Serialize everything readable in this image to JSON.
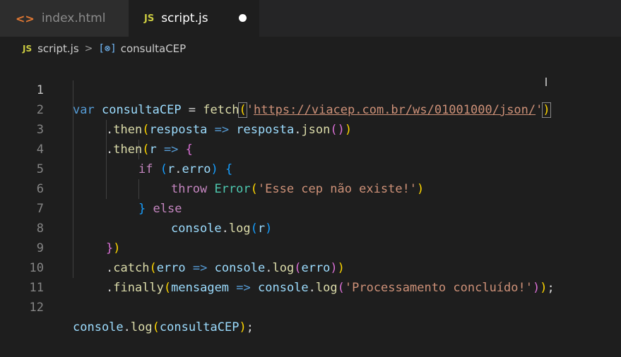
{
  "tabs": [
    {
      "label": "index.html",
      "icon": "<>",
      "active": false
    },
    {
      "label": "script.js",
      "icon": "JS",
      "active": true,
      "modified": true
    }
  ],
  "breadcrumb": {
    "file_icon": "JS",
    "file": "script.js",
    "separator": ">",
    "symbol_icon": "[⊗]",
    "symbol": "consultaCEP"
  },
  "editor": {
    "line_numbers": [
      "1",
      "2",
      "3",
      "4",
      "5",
      "6",
      "7",
      "8",
      "9",
      "10",
      "11",
      "12"
    ],
    "tokens": {
      "var": "var",
      "consultaCEP": "consultaCEP",
      "eq": " = ",
      "fetch": "fetch",
      "lp": "(",
      "rp": ")",
      "lb": "{",
      "rb": "}",
      "dot": ".",
      "arrow": " => ",
      "semi": ";",
      "url_q1": "'",
      "url": "https://viacep.com.br/ws/01001000/json/",
      "url_q2": "'",
      "then": "then",
      "resposta": "resposta",
      "json": "json",
      "empty_parens": "()",
      "r": "r",
      "if": "if",
      "erro_prop": "erro",
      "throw": "throw",
      "Error": "Error",
      "err_msg": "'Esse cep não existe!'",
      "else": "else",
      "console": "console",
      "log": "log",
      "catch": "catch",
      "erro": "erro",
      "finally": "finally",
      "mensagem": "mensagem",
      "done_msg": "'Processamento concluído!'"
    }
  },
  "colors": {
    "keyword": "#569cd6",
    "control": "#c586c0",
    "variable": "#9cdcfe",
    "function": "#dcdcaa",
    "class": "#4ec9b0",
    "string": "#ce9178",
    "bracket_1": "#ffd700",
    "bracket_2": "#da70d6",
    "bracket_3": "#179fff"
  }
}
